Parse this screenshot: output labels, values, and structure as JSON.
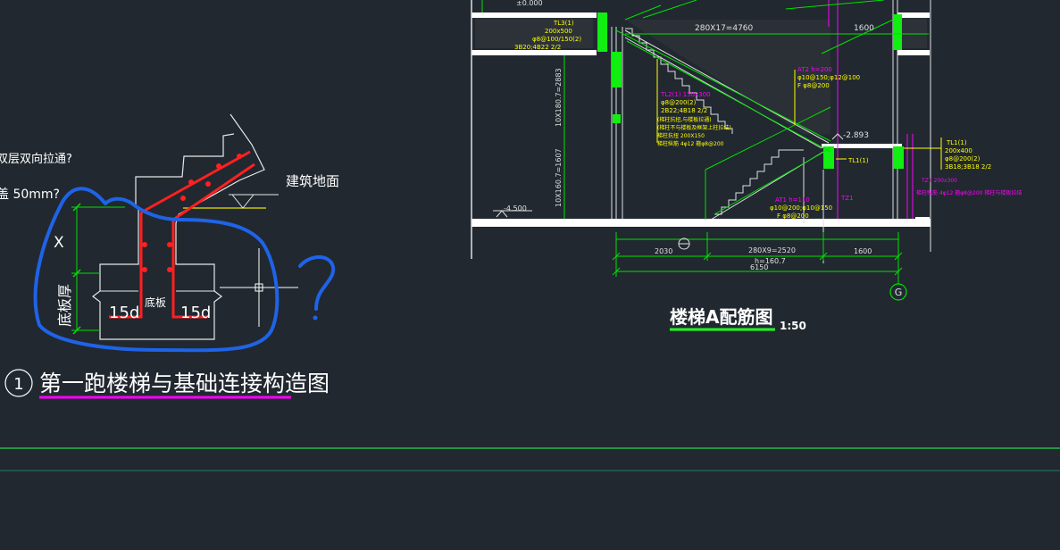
{
  "colors": {
    "background": "#212830",
    "white": "#ffffff",
    "red": "#ff2020",
    "green": "#00e000",
    "bright_green": "#22ff22",
    "yellow": "#ffff00",
    "magenta": "#ff00ff",
    "blue_annotation": "#1f63e6",
    "dim_line": "#b0b0b0"
  },
  "left_detail": {
    "fragment_line1": "双层双向拉通?",
    "fragment_line2": "盖 50mm?",
    "fragment_line3": "?",
    "ground_label": "建筑地面",
    "x_label": "X",
    "slab_thickness_label": "底板厚",
    "anchor_left": "15d",
    "anchor_right": "15d",
    "slab_label": "底板",
    "question_mark": "?",
    "circle_number": "1",
    "title": "第一跑楼梯与基础连接构造图"
  },
  "right_section": {
    "top_elev": "±0.000",
    "tl3_label": "TL3(1)",
    "tl3_size": "200x500",
    "tl3_stirrup": "φ8@100/150(2)",
    "tl3_bars": "3B20;4B22 2/2",
    "dim_top": "280X17=4760",
    "dim_top_right": "1600",
    "at2_label": "AT2 h=200",
    "at2_bars": "φ10@150;φ12@100",
    "at2_dist": "F φ8@200",
    "tl2_label": "TL2(1) 150x300",
    "tl2_stirrup": "φ8@200(2)",
    "tl2_bars": "2B22;4B18 2/2",
    "tl2_note1": "(梯柱抗扭,与楼板拉通)",
    "tl2_note2": "(梯柱不与楼板及框架上柱拉结)",
    "tl2_note3": "梯柱抗扭 200X150",
    "tl2_note4": "梯柱纵筋 4φ12 箍φ8@200",
    "vert_dim_upper": "10X180.7=2883",
    "vert_dim_lower": "10X160.7=1607",
    "elev_mid": "-2.893",
    "tl1_mid": "TL1(1)",
    "tl1_label": "TL1(1)",
    "tl1_size": "200x400",
    "tl1_stirrup": "φ8@200(2)",
    "tl1_bars": "3B18;3B18 2/2",
    "tz1_label": "TZ1 200x300",
    "tz1_note": "梯柱纵筋 4φ12 箍φ8@200 梯柱与楼板拉结",
    "at1_label": "AT1 h=110",
    "at1_bars": "φ10@200;φ10@150",
    "at1_dist": "F φ8@200",
    "tz1_small": "TZ1",
    "bottom_elev": "-4.500",
    "dim_2030": "2030",
    "dim_280x9": "280X9=2520",
    "dim_h": "h=160.7",
    "dim_1600": "1600",
    "dim_total": "6150",
    "axis_label": "G",
    "title": "楼梯A配筋图",
    "scale": "1:50"
  }
}
